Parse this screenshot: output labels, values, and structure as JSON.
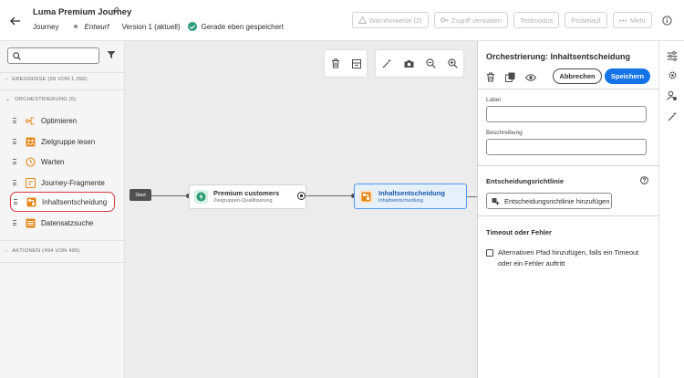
{
  "header": {
    "title": "Luma Premium Journey",
    "type": "Journey",
    "status": "Entwurf",
    "version": "Version 1 (aktuell)",
    "saved": "Gerade eben gespeichert",
    "buttons": {
      "warnings": "Warnhinweise (2)",
      "access": "Zugriff verwalten",
      "test": "Testmodus",
      "dryrun": "Probelauf",
      "more": "Mehr"
    }
  },
  "sidebar": {
    "events_header": "EREIGNISSE (58 VON 1.356)",
    "orchestration_header": "ORCHESTRIERUNG (6)",
    "actions_header": "AKTIONEN (494 VON 495)",
    "orchestration_items": [
      {
        "label": "Optimieren",
        "icon": "optimize-icon"
      },
      {
        "label": "Zielgruppe lesen",
        "icon": "audience-icon"
      },
      {
        "label": "Warten",
        "icon": "clock-icon"
      },
      {
        "label": "Journey-Fragmente",
        "icon": "fragment-icon"
      },
      {
        "label": "Inhaltsentscheidung",
        "icon": "decision-icon"
      },
      {
        "label": "Datensatzsuche",
        "icon": "dataset-icon"
      }
    ]
  },
  "canvas": {
    "start_label": "Start",
    "node1": {
      "title": "Premium customers",
      "subtitle": "Zielgruppen-Qualifizierung"
    },
    "node2": {
      "title": "Inhaltsentscheidung",
      "subtitle": "Inhaltsentscheidung"
    }
  },
  "panel": {
    "title": "Orchestrierung: Inhaltsentscheidung",
    "cancel": "Abbrechen",
    "save": "Speichern",
    "label_field": "Label",
    "description_field": "Beschreibung",
    "decision_policy_section": "Entscheidungsrichtlinie",
    "add_policy_button": "Entscheidungsrichtlinie hinzufügen",
    "timeout_section": "Timeout oder Fehler",
    "alt_path_label": "Alternativen Pfad hinzufügen, falls ein Timeout oder ein Fehler auftritt"
  },
  "colors": {
    "accent": "#1473e6",
    "selected_border": "#d7373f",
    "success": "#2d9d78",
    "orange": "#e68619"
  }
}
